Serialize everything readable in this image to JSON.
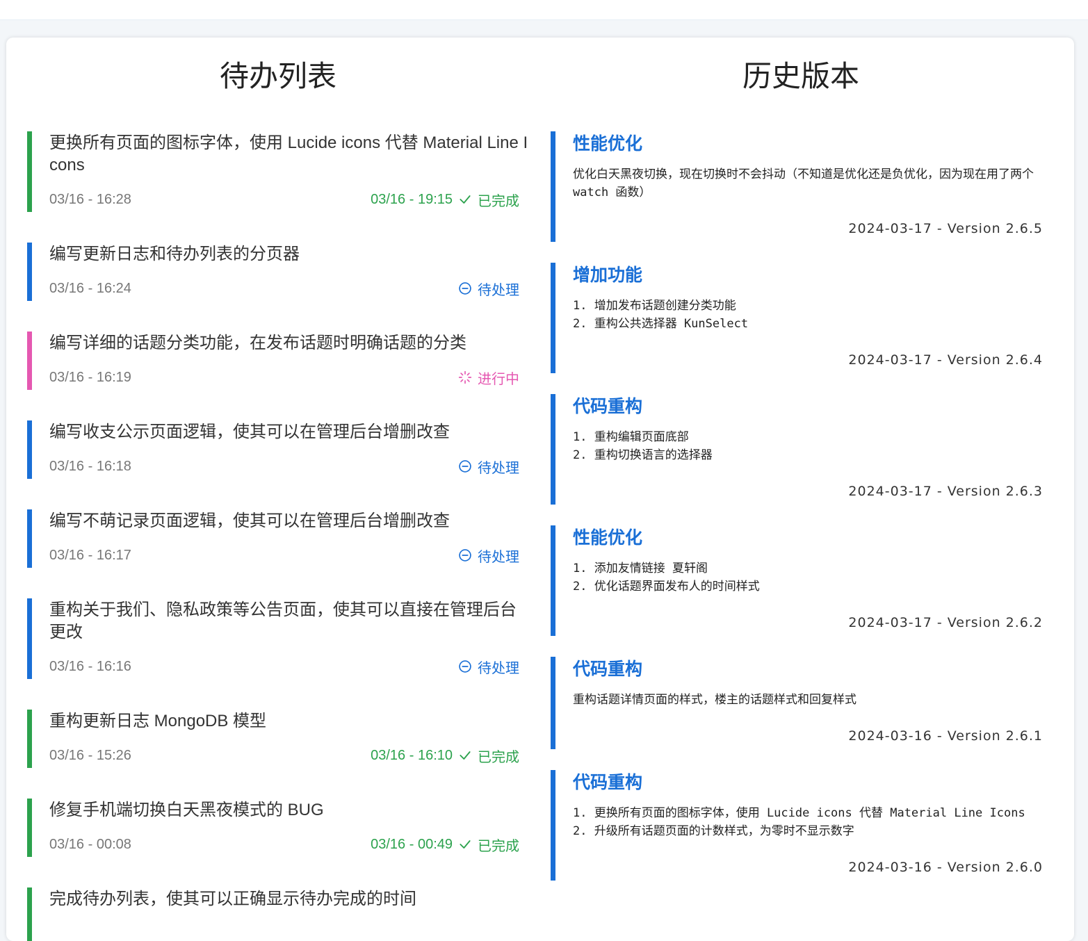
{
  "todo": {
    "title": "待办列表",
    "items": [
      {
        "text": "更换所有页面的图标字体，使用 Lucide icons 代替 Material Line Icons",
        "created": "03/16 - 16:28",
        "status": "done",
        "completed": "03/16 - 19:15",
        "status_label": "已完成"
      },
      {
        "text": "编写更新日志和待办列表的分页器",
        "created": "03/16 - 16:24",
        "status": "pending",
        "completed": "",
        "status_label": "待处理"
      },
      {
        "text": "编写详细的话题分类功能，在发布话题时明确话题的分类",
        "created": "03/16 - 16:19",
        "status": "progress",
        "completed": "",
        "status_label": "进行中"
      },
      {
        "text": "编写收支公示页面逻辑，使其可以在管理后台增删改查",
        "created": "03/16 - 16:18",
        "status": "pending",
        "completed": "",
        "status_label": "待处理"
      },
      {
        "text": "编写不萌记录页面逻辑，使其可以在管理后台增删改查",
        "created": "03/16 - 16:17",
        "status": "pending",
        "completed": "",
        "status_label": "待处理"
      },
      {
        "text": "重构关于我们、隐私政策等公告页面，使其可以直接在管理后台更改",
        "created": "03/16 - 16:16",
        "status": "pending",
        "completed": "",
        "status_label": "待处理"
      },
      {
        "text": "重构更新日志 MongoDB 模型",
        "created": "03/16 - 15:26",
        "status": "done",
        "completed": "03/16 - 16:10",
        "status_label": "已完成"
      },
      {
        "text": "修复手机端切换白天黑夜模式的 BUG",
        "created": "03/16 - 00:08",
        "status": "done",
        "completed": "03/16 - 00:49",
        "status_label": "已完成"
      },
      {
        "text": "完成待办列表，使其可以正确显示待办完成的时间",
        "created": "",
        "status": "done",
        "completed": "",
        "status_label": ""
      }
    ]
  },
  "history": {
    "title": "历史版本",
    "items": [
      {
        "title": "性能优化",
        "lines": [
          "优化白天黑夜切换，现在切换时不会抖动（不知道是优化还是负优化，因为现在用了两个 watch 函数）"
        ],
        "footer": "2024-03-17 - Version 2.6.5"
      },
      {
        "title": "增加功能",
        "lines": [
          "1. 增加发布话题创建分类功能",
          "2. 重构公共选择器 KunSelect"
        ],
        "footer": "2024-03-17 - Version 2.6.4"
      },
      {
        "title": "代码重构",
        "lines": [
          "1. 重构编辑页面底部",
          "2. 重构切换语言的选择器"
        ],
        "footer": "2024-03-17 - Version 2.6.3"
      },
      {
        "title": "性能优化",
        "lines": [
          "1. 添加友情链接 夏轩阁",
          "2. 优化话题界面发布人的时间样式"
        ],
        "footer": "2024-03-17 - Version 2.6.2"
      },
      {
        "title": "代码重构",
        "lines": [
          "重构话题详情页面的样式，楼主的话题样式和回复样式"
        ],
        "footer": "2024-03-16 - Version 2.6.1"
      },
      {
        "title": "代码重构",
        "lines": [
          "1. 更换所有页面的图标字体，使用 Lucide icons 代替 Material Line Icons",
          "2. 升级所有话题页面的计数样式，为零时不显示数字"
        ],
        "footer": "2024-03-16 - Version 2.6.0"
      }
    ]
  },
  "colors": {
    "done": "#2ca24d",
    "pending": "#1a6fd6",
    "progress": "#e558b1",
    "accent": "#1a6fd6"
  },
  "icons": {
    "done": "check-icon",
    "pending": "minus-circle-icon",
    "progress": "loader-icon"
  }
}
